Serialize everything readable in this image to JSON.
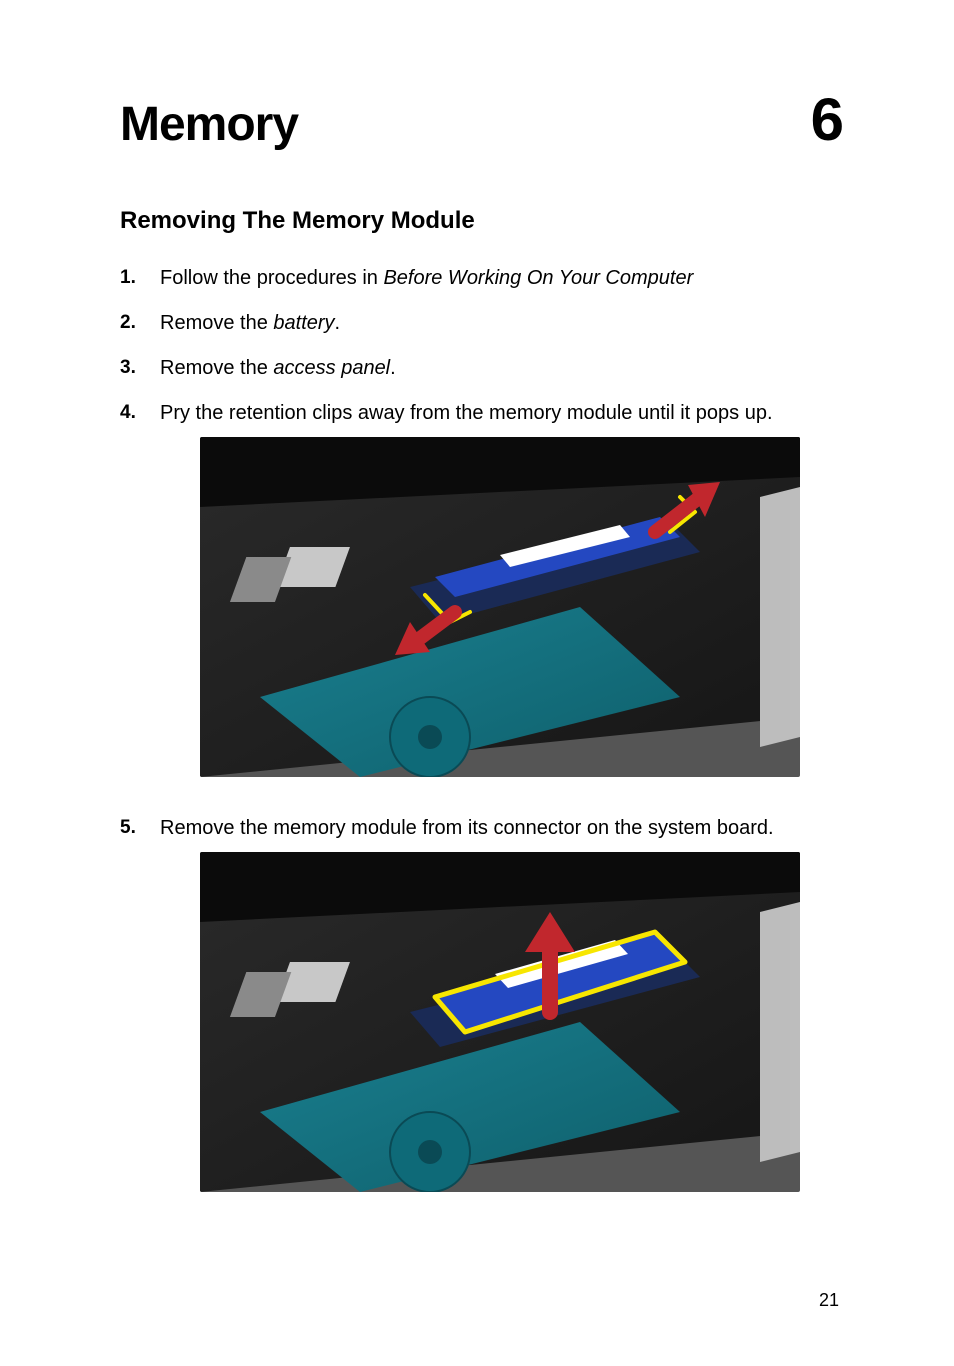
{
  "chapter": {
    "title": "Memory",
    "number": "6"
  },
  "section": {
    "title": "Removing The Memory Module"
  },
  "steps": [
    {
      "num": "1.",
      "prefix": "Follow the procedures in ",
      "italic": "Before Working On Your Computer",
      "suffix": ""
    },
    {
      "num": "2.",
      "prefix": "Remove the ",
      "italic": "battery",
      "suffix": "."
    },
    {
      "num": "3.",
      "prefix": "Remove the ",
      "italic": "access panel",
      "suffix": "."
    },
    {
      "num": "4.",
      "prefix": "Pry the retention clips away from the memory module until it pops up.",
      "italic": "",
      "suffix": ""
    },
    {
      "num": "5.",
      "prefix": "Remove the memory module from its connector on the system board.",
      "italic": "",
      "suffix": ""
    }
  ],
  "figures": {
    "fig1_alt": "Laptop interior showing a memory module popping up with retention clips pried outward; red arrows indicate clip direction; yellow outline highlights clips and module edge.",
    "fig2_alt": "Laptop interior showing the memory module highlighted in yellow being lifted out of its connector; a red arrow points upward."
  },
  "page_number": "21"
}
